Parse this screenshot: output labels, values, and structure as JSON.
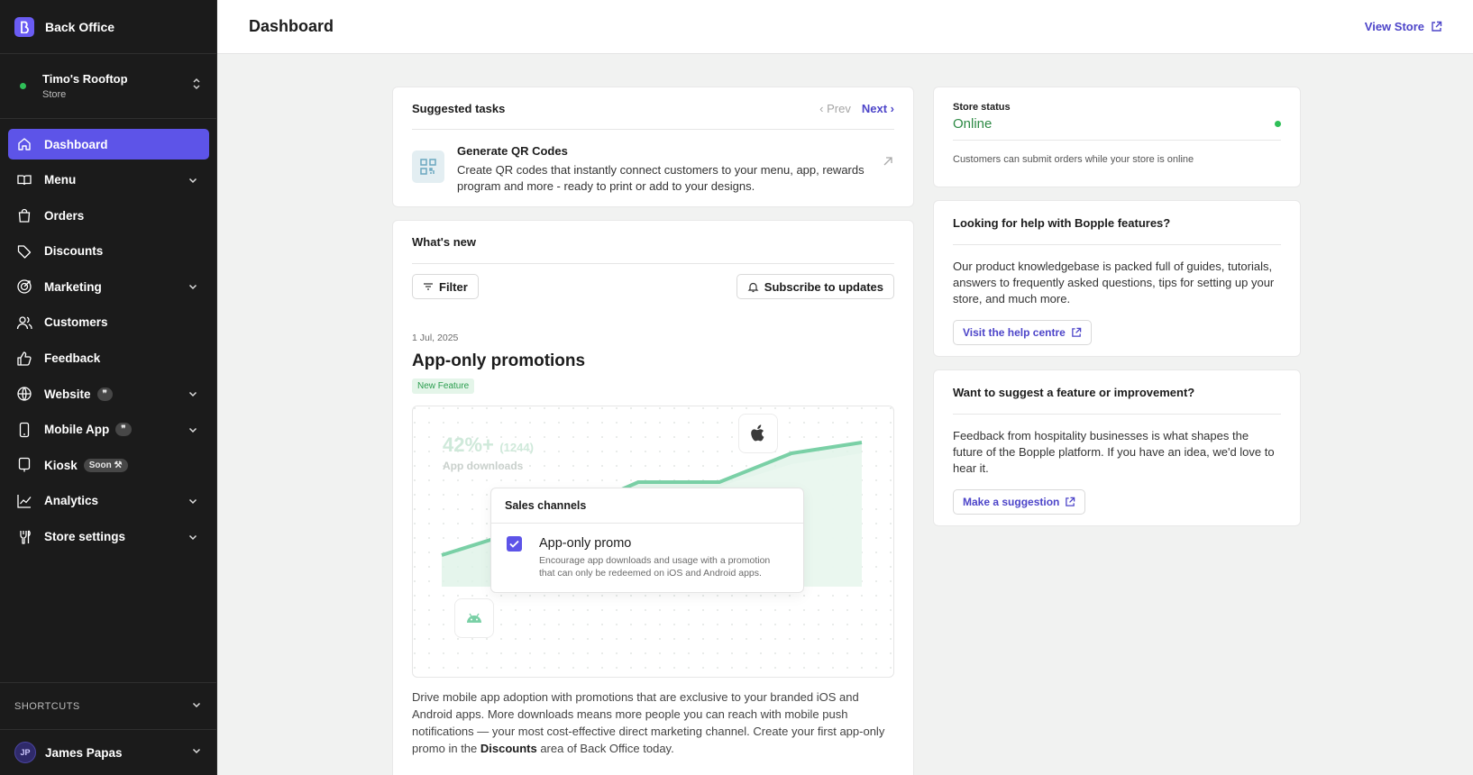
{
  "app": {
    "brand": "Back Office"
  },
  "store": {
    "name": "Timo's Rooftop",
    "type": "Store"
  },
  "nav": [
    {
      "id": "dashboard",
      "label": "Dashboard",
      "icon": "home-icon",
      "chevron": false,
      "active": true
    },
    {
      "id": "menu",
      "label": "Menu",
      "icon": "book-icon",
      "chevron": true
    },
    {
      "id": "orders",
      "label": "Orders",
      "icon": "shopping-bag-icon",
      "chevron": false
    },
    {
      "id": "discounts",
      "label": "Discounts",
      "icon": "tag-icon",
      "chevron": false
    },
    {
      "id": "marketing",
      "label": "Marketing",
      "icon": "target-icon",
      "chevron": true
    },
    {
      "id": "customers",
      "label": "Customers",
      "icon": "users-icon",
      "chevron": false
    },
    {
      "id": "feedback",
      "label": "Feedback",
      "icon": "thumbs-up-icon",
      "chevron": false
    },
    {
      "id": "website",
      "label": "Website",
      "icon": "globe-icon",
      "chevron": true,
      "badge": "❞"
    },
    {
      "id": "mobile-app",
      "label": "Mobile App",
      "icon": "smartphone-icon",
      "chevron": true,
      "badge": "❞"
    },
    {
      "id": "kiosk",
      "label": "Kiosk",
      "icon": "tablet-icon",
      "chevron": false,
      "badge": "Soon ⚒"
    },
    {
      "id": "analytics",
      "label": "Analytics",
      "icon": "line-chart-icon",
      "chevron": true
    },
    {
      "id": "store-settings",
      "label": "Store settings",
      "icon": "wrench-icon",
      "chevron": true
    }
  ],
  "shortcuts": {
    "label": "SHORTCUTS"
  },
  "user": {
    "initials": "JP",
    "name": "James Papas"
  },
  "header": {
    "title": "Dashboard",
    "view_store": "View Store"
  },
  "tasks": {
    "title": "Suggested tasks",
    "prev": "Prev",
    "next": "Next",
    "item": {
      "title": "Generate QR Codes",
      "description": "Create QR codes that instantly connect customers to your menu, app, rewards program and more - ready to print or add to your designs."
    }
  },
  "news": {
    "title": "What's new",
    "filter": "Filter",
    "subscribe": "Subscribe to updates",
    "post": {
      "date": "1 Jul, 2025",
      "title": "App-only promotions",
      "tag": "New Feature",
      "illustration": {
        "stat": "42%+",
        "stat_sub": "(1244)",
        "stat_label": "App downloads",
        "panel_title": "Sales channels",
        "option_title": "App-only promo",
        "option_desc_1": "Encourage app downloads and usage with a promotion",
        "option_desc_2": "that can only be redeemed on iOS and Android apps."
      },
      "body_1": "Drive mobile app adoption with promotions that are exclusive to your branded iOS and Android apps. More downloads means more people you can reach with mobile push notifications — your most cost-effective direct marketing channel. Create your first app-only promo in the ",
      "body_bold": "Discounts",
      "body_2": " area of Back Office today."
    }
  },
  "status": {
    "label": "Store status",
    "value": "Online",
    "note": "Customers can submit orders while your store is online"
  },
  "help": {
    "title": "Looking for help with Bopple features?",
    "text": "Our product knowledgebase is packed full of guides, tutorials, answers to frequently asked questions, tips for setting up your store, and much more.",
    "link": "Visit the help centre"
  },
  "suggest": {
    "title": "Want to suggest a feature or improvement?",
    "text": "Feedback from hospitality businesses is what shapes the future of the Bopple platform. If you have an idea, we'd love to hear it.",
    "link": "Make a suggestion"
  },
  "colors": {
    "accent": "#5d54e8",
    "link": "#4d45c9",
    "online": "#2fbf58",
    "sidebar": "#1b1b1b"
  }
}
